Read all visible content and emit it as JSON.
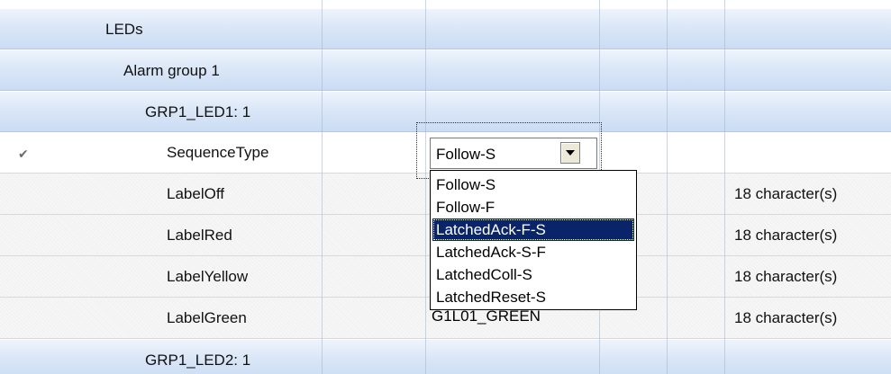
{
  "grid": {
    "rows": [
      {
        "type": "group",
        "label": "LEDs",
        "indent": 1
      },
      {
        "type": "group",
        "label": "Alarm group 1",
        "indent": 2
      },
      {
        "type": "group",
        "label": "GRP1_LED1: 1",
        "indent": 3
      },
      {
        "type": "data",
        "label": "SequenceType",
        "checked": true,
        "editing": true,
        "note": ""
      },
      {
        "type": "data",
        "label": "LabelOff",
        "value": "",
        "note": "18 character(s)"
      },
      {
        "type": "data",
        "label": "LabelRed",
        "value": "",
        "note": "18 character(s)"
      },
      {
        "type": "data",
        "label": "LabelYellow",
        "value": "",
        "note": "18 character(s)"
      },
      {
        "type": "data",
        "label": "LabelGreen",
        "value": "G1L01_GREEN",
        "note": "18 character(s)"
      },
      {
        "type": "group",
        "label": "GRP1_LED2: 1",
        "indent": 3
      }
    ],
    "check_glyph": "✔"
  },
  "editor": {
    "combo_value": "Follow-S",
    "options": [
      "Follow-S",
      "Follow-F",
      "LatchedAck-F-S",
      "LatchedAck-S-F",
      "LatchedColl-S",
      "LatchedReset-S"
    ],
    "highlighted_index": 2
  },
  "colors": {
    "group_header": "#cbdcf3",
    "selection": "#0a246a"
  }
}
